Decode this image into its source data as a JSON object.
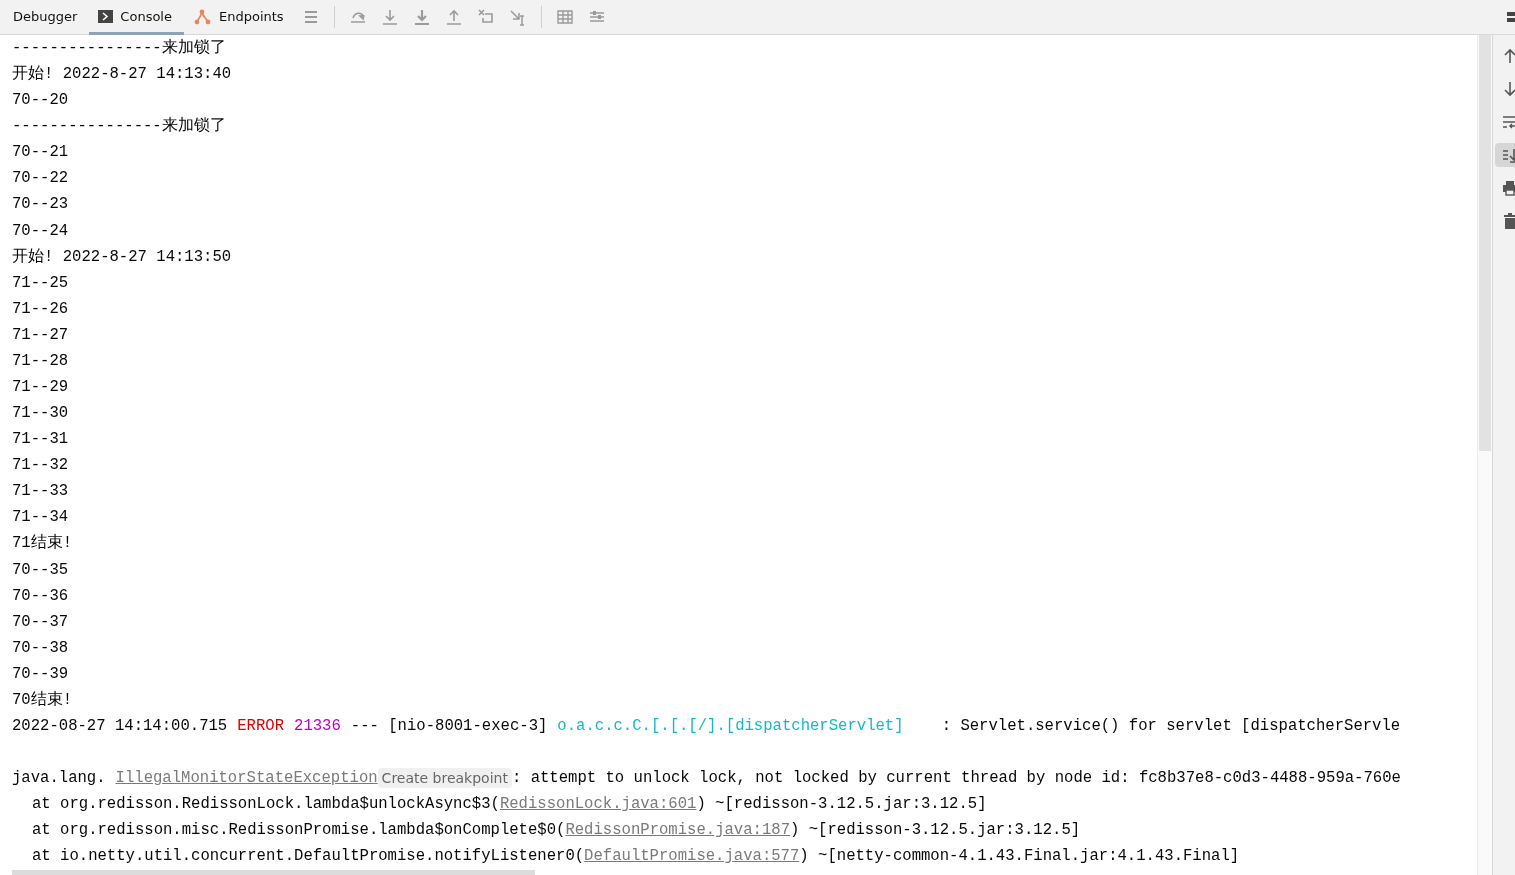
{
  "tabs": [
    {
      "label": "Debugger",
      "selected": false
    },
    {
      "label": "Console",
      "selected": true
    },
    {
      "label": "Endpoints",
      "selected": false
    }
  ],
  "side_buttons": [
    {
      "kind": "up",
      "selected": false
    },
    {
      "kind": "down",
      "selected": false
    },
    {
      "kind": "wrap",
      "selected": false
    },
    {
      "kind": "scroll-end",
      "selected": true
    },
    {
      "kind": "print",
      "selected": false
    },
    {
      "kind": "trash",
      "selected": false
    }
  ],
  "console_lines": [
    {
      "kind": "plain",
      "segments": [
        {
          "kind": "text",
          "text": "----------------来加锁了"
        }
      ]
    },
    {
      "kind": "plain",
      "segments": [
        {
          "kind": "text",
          "text": "开始! 2022-8-27 14:13:40"
        }
      ]
    },
    {
      "kind": "plain",
      "segments": [
        {
          "kind": "text",
          "text": "70--20"
        }
      ]
    },
    {
      "kind": "plain",
      "segments": [
        {
          "kind": "text",
          "text": "----------------来加锁了"
        }
      ]
    },
    {
      "kind": "plain",
      "segments": [
        {
          "kind": "text",
          "text": "70--21"
        }
      ]
    },
    {
      "kind": "plain",
      "segments": [
        {
          "kind": "text",
          "text": "70--22"
        }
      ]
    },
    {
      "kind": "plain",
      "segments": [
        {
          "kind": "text",
          "text": "70--23"
        }
      ]
    },
    {
      "kind": "plain",
      "segments": [
        {
          "kind": "text",
          "text": "70--24"
        }
      ]
    },
    {
      "kind": "plain",
      "segments": [
        {
          "kind": "text",
          "text": "开始! 2022-8-27 14:13:50"
        }
      ]
    },
    {
      "kind": "plain",
      "segments": [
        {
          "kind": "text",
          "text": "71--25"
        }
      ]
    },
    {
      "kind": "plain",
      "segments": [
        {
          "kind": "text",
          "text": "71--26"
        }
      ]
    },
    {
      "kind": "plain",
      "segments": [
        {
          "kind": "text",
          "text": "71--27"
        }
      ]
    },
    {
      "kind": "plain",
      "segments": [
        {
          "kind": "text",
          "text": "71--28"
        }
      ]
    },
    {
      "kind": "plain",
      "segments": [
        {
          "kind": "text",
          "text": "71--29"
        }
      ]
    },
    {
      "kind": "plain",
      "segments": [
        {
          "kind": "text",
          "text": "71--30"
        }
      ]
    },
    {
      "kind": "plain",
      "segments": [
        {
          "kind": "text",
          "text": "71--31"
        }
      ]
    },
    {
      "kind": "plain",
      "segments": [
        {
          "kind": "text",
          "text": "71--32"
        }
      ]
    },
    {
      "kind": "plain",
      "segments": [
        {
          "kind": "text",
          "text": "71--33"
        }
      ]
    },
    {
      "kind": "plain",
      "segments": [
        {
          "kind": "text",
          "text": "71--34"
        }
      ]
    },
    {
      "kind": "plain",
      "segments": [
        {
          "kind": "text",
          "text": "71结束!"
        }
      ]
    },
    {
      "kind": "plain",
      "segments": [
        {
          "kind": "text",
          "text": "70--35"
        }
      ]
    },
    {
      "kind": "plain",
      "segments": [
        {
          "kind": "text",
          "text": "70--36"
        }
      ]
    },
    {
      "kind": "plain",
      "segments": [
        {
          "kind": "text",
          "text": "70--37"
        }
      ]
    },
    {
      "kind": "plain",
      "segments": [
        {
          "kind": "text",
          "text": "70--38"
        }
      ]
    },
    {
      "kind": "plain",
      "segments": [
        {
          "kind": "text",
          "text": "70--39"
        }
      ]
    },
    {
      "kind": "plain",
      "segments": [
        {
          "kind": "text",
          "text": "70结束!"
        }
      ]
    },
    {
      "kind": "plain",
      "segments": [
        {
          "kind": "text",
          "text": "2022-08-27 14:14:00.715"
        },
        {
          "kind": "error",
          "text": "ERROR"
        },
        {
          "kind": "pid",
          "text": "21336"
        },
        {
          "kind": "text",
          "text": "--- [nio-8001-exec-3]"
        },
        {
          "kind": "logger",
          "text": "o.a.c.c.C.[.[.[/].[dispatcherServlet]"
        },
        {
          "kind": "text",
          "text": "   : Servlet.service() for servlet [dispatcherServle"
        }
      ]
    },
    {
      "kind": "blank"
    },
    {
      "kind": "plain",
      "segments": [
        {
          "kind": "text",
          "text": "java.lang."
        },
        {
          "kind": "link",
          "text": "IllegalMonitorStateException"
        },
        {
          "kind": "hint",
          "text": "Create breakpoint"
        },
        {
          "kind": "text",
          "text": ": attempt to unlock lock, not locked by current thread by node id: fc8b37e8-c0d3-4488-959a-760e"
        }
      ]
    },
    {
      "kind": "stack",
      "segments": [
        {
          "kind": "text",
          "text": "at org.redisson.RedissonLock.lambda$unlockAsync$3("
        },
        {
          "kind": "link",
          "text": "RedissonLock.java:601"
        },
        {
          "kind": "text",
          "text": ") ~[redisson-3.12.5.jar:3.12.5]"
        }
      ]
    },
    {
      "kind": "stack",
      "segments": [
        {
          "kind": "text",
          "text": "at org.redisson.misc.RedissonPromise.lambda$onComplete$0("
        },
        {
          "kind": "link",
          "text": "RedissonPromise.java:187"
        },
        {
          "kind": "text",
          "text": ") ~[redisson-3.12.5.jar:3.12.5]"
        }
      ]
    },
    {
      "kind": "stack",
      "segments": [
        {
          "kind": "text",
          "text": "at io.netty.util.concurrent.DefaultPromise.notifyListener0("
        },
        {
          "kind": "link",
          "text": "DefaultPromise.java:577"
        },
        {
          "kind": "text",
          "text": ") ~[netty-common-4.1.43.Final.jar:4.1.43.Final]"
        }
      ]
    }
  ]
}
